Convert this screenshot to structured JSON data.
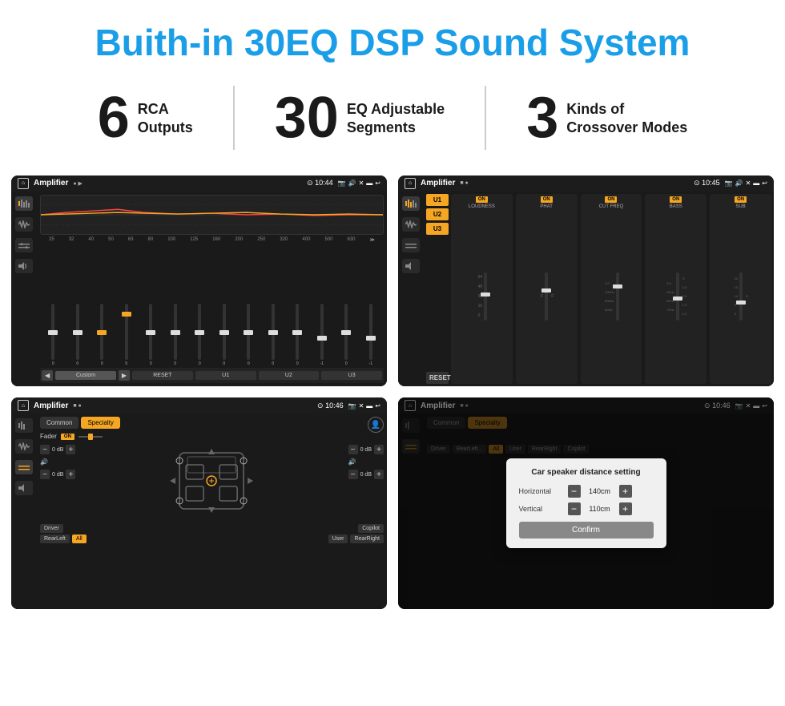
{
  "header": {
    "title": "Buith-in 30EQ DSP Sound System"
  },
  "stats": [
    {
      "number": "6",
      "line1": "RCA",
      "line2": "Outputs"
    },
    {
      "number": "30",
      "line1": "EQ Adjustable",
      "line2": "Segments"
    },
    {
      "number": "3",
      "line1": "Kinds of",
      "line2": "Crossover Modes"
    }
  ],
  "screens": [
    {
      "id": "screen1",
      "status_bar": {
        "title": "Amplifier",
        "time": "10:44"
      },
      "type": "eq"
    },
    {
      "id": "screen2",
      "status_bar": {
        "title": "Amplifier",
        "time": "10:45"
      },
      "type": "channels"
    },
    {
      "id": "screen3",
      "status_bar": {
        "title": "Amplifier",
        "time": "10:46"
      },
      "type": "fader"
    },
    {
      "id": "screen4",
      "status_bar": {
        "title": "Amplifier",
        "time": "10:46"
      },
      "type": "distance",
      "dialog": {
        "title": "Car speaker distance setting",
        "horizontal_label": "Horizontal",
        "horizontal_value": "140cm",
        "vertical_label": "Vertical",
        "vertical_value": "110cm",
        "confirm_label": "Confirm"
      }
    }
  ],
  "eq": {
    "labels": [
      "25",
      "32",
      "40",
      "50",
      "63",
      "80",
      "100",
      "125",
      "160",
      "200",
      "250",
      "320",
      "400",
      "500",
      "630"
    ],
    "values": [
      0,
      0,
      0,
      5,
      0,
      0,
      0,
      0,
      0,
      0,
      0,
      -1,
      0,
      -1
    ],
    "presets": [
      "Custom",
      "RESET",
      "U1",
      "U2",
      "U3"
    ]
  },
  "channels": {
    "u_buttons": [
      "U1",
      "U2",
      "U3"
    ],
    "channel_names": [
      "LOUDNESS",
      "PHAT",
      "CUT FREQ",
      "BASS",
      "SUB"
    ],
    "reset_label": "RESET"
  },
  "fader": {
    "tabs": [
      "Common",
      "Specialty"
    ],
    "header": "Fader",
    "on_label": "ON",
    "bottom_btns": [
      "Driver",
      "RearLeft",
      "All",
      "User",
      "RearRight",
      "Copilot"
    ]
  },
  "distance_dialog": {
    "title": "Car speaker distance setting",
    "horizontal_label": "Horizontal",
    "horizontal_value": "140cm",
    "vertical_label": "Vertical",
    "vertical_value": "110cm",
    "confirm_label": "Confirm"
  }
}
